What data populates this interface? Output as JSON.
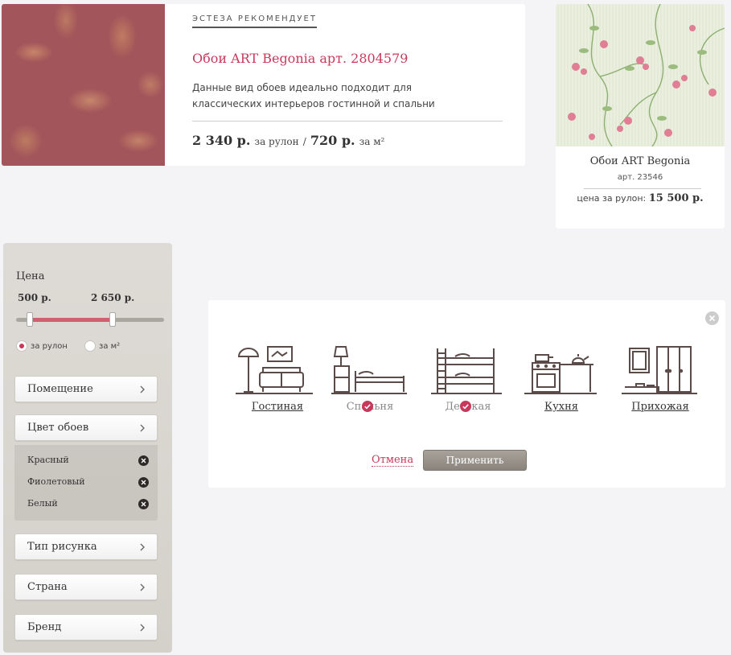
{
  "recommended": {
    "label": "ЭСТЕЗА РЕКОМЕНДУЕТ",
    "title": "Обои ART Begonia арт. 2804579",
    "description": "Данные вид обоев идеально подходит для классических интерьеров гостинной и спальни",
    "price_roll": "2 340 р.",
    "per_roll": "за рулон",
    "separator": "/",
    "price_m2": "720 р.",
    "per_m2": "за м²"
  },
  "product": {
    "name": "Обои ART Begonia",
    "article": "арт. 23546",
    "price_label": "цена за рулон:",
    "price": "15 500 р."
  },
  "filter": {
    "price_title": "Цена",
    "min": "500 р.",
    "max": "2 650 р.",
    "range_fraction": {
      "min": 0.09,
      "max": 0.65
    },
    "unit_roll": "за рулон",
    "unit_m2": "за м²",
    "unit_selected": "roll",
    "room_label": "Помещение",
    "color_label": "Цвет обоев",
    "colors": [
      "Красный",
      "Фиолетовый",
      "Белый"
    ],
    "pattern_label": "Тип рисунка",
    "country_label": "Страна",
    "brand_label": "Бренд"
  },
  "rooms_popup": {
    "rooms": [
      {
        "label": "Гостиная",
        "checked": false,
        "icon": "living-room-icon"
      },
      {
        "label": "Спальня",
        "checked": true,
        "icon": "bedroom-icon"
      },
      {
        "label": "Детская",
        "checked": true,
        "icon": "kids-room-icon"
      },
      {
        "label": "Кухня",
        "checked": false,
        "icon": "kitchen-icon"
      },
      {
        "label": "Прихожая",
        "checked": false,
        "icon": "hallway-icon"
      }
    ],
    "cancel": "Отмена",
    "apply": "Применить"
  },
  "colors": {
    "accent": "#c8385a",
    "slider_fill": "#d06070",
    "icon": "#5a4a48",
    "apply_button": "#948e87"
  }
}
